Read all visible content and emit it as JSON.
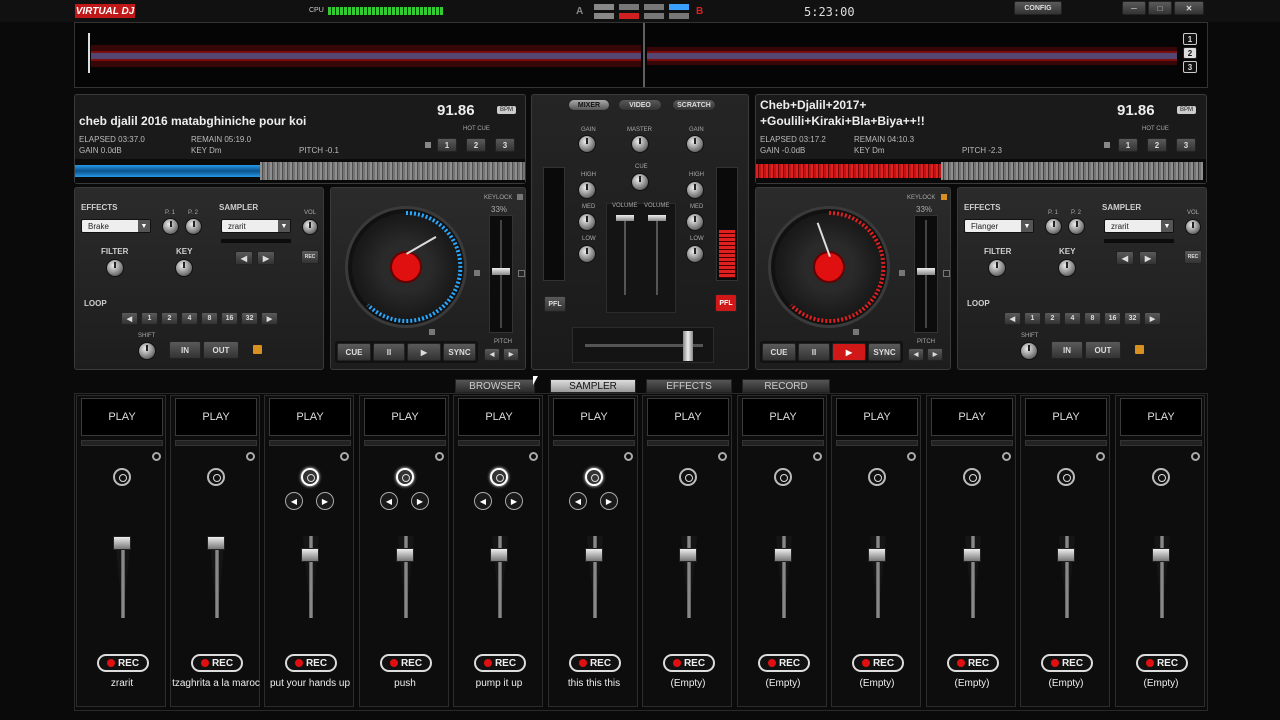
{
  "topbar": {
    "logo": "VIRTUAL DJ",
    "cpu_label": "CPU",
    "clock": "5:23:00",
    "config": "CONFIG",
    "deck_a": "A",
    "deck_b": "B"
  },
  "overview": {
    "pages": [
      "1",
      "2",
      "3"
    ]
  },
  "deck_left": {
    "title": "cheb djalil 2016 matabghiniche pour koi",
    "bpm": "91.86",
    "bpm_label": "BPM",
    "elapsed": "ELAPSED 03:37.0",
    "remain": "REMAIN 05:19.0",
    "gain": "GAIN 0.0dB",
    "key": "KEY Dm",
    "pitch": "PITCH -0.1",
    "hot_cue_label": "HOT CUE",
    "hot_cues": [
      "1",
      "2",
      "3"
    ],
    "effects_label": "EFFECTS",
    "effect": "Brake",
    "p1": "P. 1",
    "p2": "P. 2",
    "sampler_label": "SAMPLER",
    "sampler": "zrarit",
    "vol": "VOL",
    "rec": "REC",
    "filter": "FILTER",
    "key_label": "KEY",
    "loop_label": "LOOP",
    "loops": [
      "1",
      "2",
      "4",
      "8",
      "16",
      "32"
    ],
    "shift": "SHIFT",
    "in": "IN",
    "out": "OUT",
    "keylock": "KEYLOCK",
    "keylock_pct": "33%",
    "pitch_label": "PITCH",
    "cue": "CUE",
    "pause": "II",
    "play": "▶",
    "sync": "SYNC"
  },
  "deck_right": {
    "title_line1": "Cheb+Djalil+2017+",
    "title_line2": "+Goulili+Kiraki+Bla+Biya++!!",
    "bpm": "91.86",
    "bpm_label": "BPM",
    "elapsed": "ELAPSED 03:17.2",
    "remain": "REMAIN 04:10.3",
    "gain": "GAIN -0.0dB",
    "key": "KEY Dm",
    "pitch": "PITCH -2.3",
    "hot_cue_label": "HOT CUE",
    "hot_cues": [
      "1",
      "2",
      "3"
    ],
    "effects_label": "EFFECTS",
    "effect": "Flanger",
    "p1": "P. 1",
    "p2": "P. 2",
    "sampler_label": "SAMPLER",
    "sampler": "zrarit",
    "vol": "VOL",
    "rec": "REC",
    "filter": "FILTER",
    "key_label": "KEY",
    "loop_label": "LOOP",
    "loops": [
      "1",
      "2",
      "4",
      "8",
      "16",
      "32"
    ],
    "shift": "SHIFT",
    "in": "IN",
    "out": "OUT",
    "keylock": "KEYLOCK",
    "keylock_pct": "33%",
    "pitch_label": "PITCH",
    "cue": "CUE",
    "pause": "II",
    "play": "▶",
    "sync": "SYNC"
  },
  "mixer": {
    "tabs": [
      "MIXER",
      "VIDEO",
      "SCRATCH"
    ],
    "gain": "GAIN",
    "master": "MASTER",
    "cue": "CUE",
    "high": "HIGH",
    "med": "MED",
    "low": "LOW",
    "volume": "VOLUME",
    "pfl": "PFL"
  },
  "tabs": [
    "BROWSER",
    "SAMPLER",
    "EFFECTS",
    "RECORD"
  ],
  "sampler": {
    "play": "PLAY",
    "rec": "REC",
    "slots": [
      "zrarit",
      "tzaghrita a la maroc",
      "put your hands up",
      "push",
      "pump it up",
      "this this this",
      "(Empty)",
      "(Empty)",
      "(Empty)",
      "(Empty)",
      "(Empty)",
      "(Empty)"
    ]
  },
  "colors": {
    "left_wave": "#2aa8ff",
    "right_wave": "#e02020",
    "accent_red": "#e01010"
  }
}
